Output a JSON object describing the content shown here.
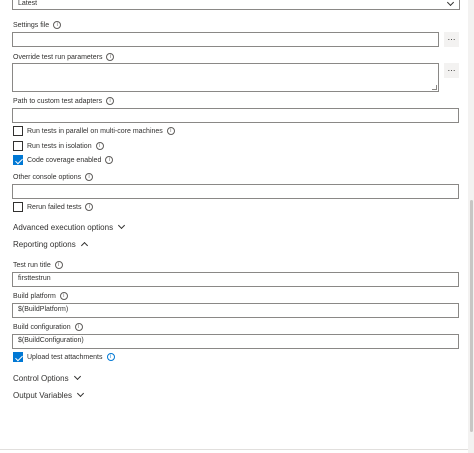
{
  "version_select": {
    "value": "Latest"
  },
  "settings_file": {
    "label": "Settings file",
    "value": "",
    "browse_label": "…"
  },
  "override_params": {
    "label": "Override test run parameters",
    "value": "",
    "browse_label": "…"
  },
  "custom_adapters": {
    "label": "Path to custom test adapters",
    "value": ""
  },
  "checkboxes": {
    "parallel": {
      "label": "Run tests in parallel on multi-core machines",
      "checked": false
    },
    "isolation": {
      "label": "Run tests in isolation",
      "checked": false
    },
    "coverage": {
      "label": "Code coverage enabled",
      "checked": true
    }
  },
  "console_options": {
    "label": "Other console options",
    "value": ""
  },
  "rerun": {
    "label": "Rerun failed tests",
    "checked": false
  },
  "sections": {
    "advanced": "Advanced execution options",
    "reporting": "Reporting options",
    "control": "Control Options",
    "output": "Output Variables"
  },
  "reporting": {
    "test_run_title": {
      "label": "Test run title",
      "value": "firsttestrun"
    },
    "build_platform": {
      "label": "Build platform",
      "value": "$(BuildPlatform)"
    },
    "build_configuration": {
      "label": "Build configuration",
      "value": "$(BuildConfiguration)"
    },
    "upload_attachments": {
      "label": "Upload test attachments",
      "checked": true
    }
  },
  "colors": {
    "accent": "#0078d4",
    "border": "#8a8886",
    "text": "#323130"
  }
}
